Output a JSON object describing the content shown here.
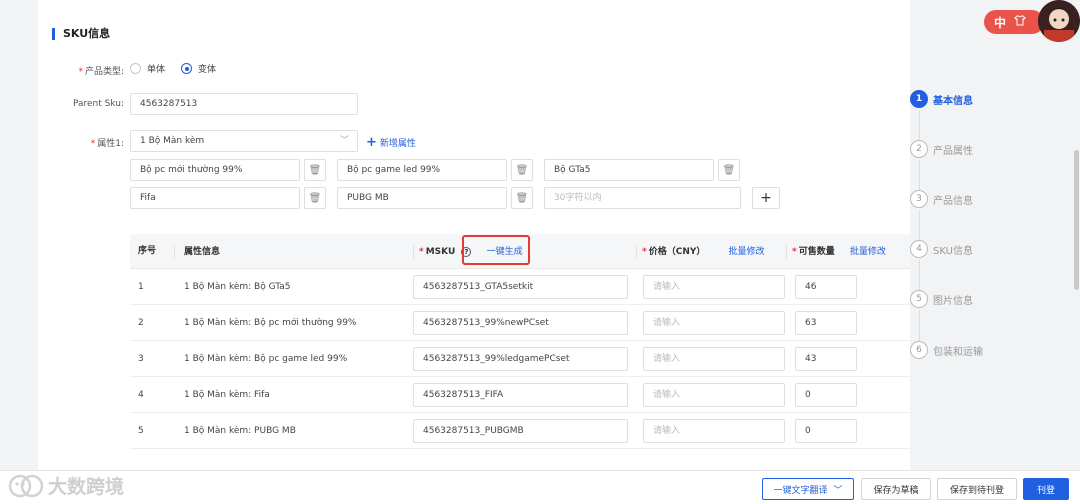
{
  "section": {
    "title": "SKU信息"
  },
  "form": {
    "product_type": {
      "label": "产品类型:",
      "options": [
        "单体",
        "变体"
      ],
      "selected": "变体"
    },
    "parent_sku": {
      "label": "Parent Sku:",
      "value": "4563287513"
    },
    "attribute": {
      "label": "属性1:",
      "value": "1 Bộ Màn kèm",
      "add_label": "新增属性"
    },
    "attribute_values": [
      "Bộ pc mới thường 99%",
      "Bộ pc game led 99%",
      "Bộ GTa5",
      "Fifa",
      "PUBG MB"
    ],
    "attribute_placeholder": "30字符以内"
  },
  "table": {
    "headers": {
      "index": "序号",
      "attr": "属性信息",
      "msku": "MSKU",
      "generate": "一键生成",
      "price": "价格（CNY）",
      "price_batch": "批量修改",
      "stock": "可售数量",
      "stock_batch": "批量修改"
    },
    "price_placeholder": "请输入",
    "rows": [
      {
        "index": "1",
        "attr": "1 Bộ Màn kèm: Bộ GTa5",
        "msku": "4563287513_GTA5setkit",
        "stock": "46"
      },
      {
        "index": "2",
        "attr": "1 Bộ Màn kèm: Bộ pc mới thường 99%",
        "msku": "4563287513_99%newPCset",
        "stock": "63"
      },
      {
        "index": "3",
        "attr": "1 Bộ Màn kèm: Bộ pc game led 99%",
        "msku": "4563287513_99%ledgamePCset",
        "stock": "43"
      },
      {
        "index": "4",
        "attr": "1 Bộ Màn kèm: Fifa",
        "msku": "4563287513_FIFA",
        "stock": "0"
      },
      {
        "index": "5",
        "attr": "1 Bộ Màn kèm: PUBG MB",
        "msku": "4563287513_PUBGMB",
        "stock": "0"
      }
    ]
  },
  "steps": [
    {
      "num": "1",
      "label": "基本信息",
      "active": true
    },
    {
      "num": "2",
      "label": "产品属性",
      "active": false
    },
    {
      "num": "3",
      "label": "产品信息",
      "active": false
    },
    {
      "num": "4",
      "label": "SKU信息",
      "active": false
    },
    {
      "num": "5",
      "label": "图片信息",
      "active": false
    },
    {
      "num": "6",
      "label": "包装和运输",
      "active": false
    }
  ],
  "footer": {
    "translate": "一键文字翻译",
    "save_draft": "保存为草稿",
    "save_pending": "保存到待刊登",
    "publish": "刊登"
  },
  "topbar": {
    "lang": "中"
  },
  "watermark": {
    "brand": "大数跨境"
  },
  "colors": {
    "primary": "#1f5fe0",
    "highlight": "#e53935",
    "required": "#e03131"
  }
}
